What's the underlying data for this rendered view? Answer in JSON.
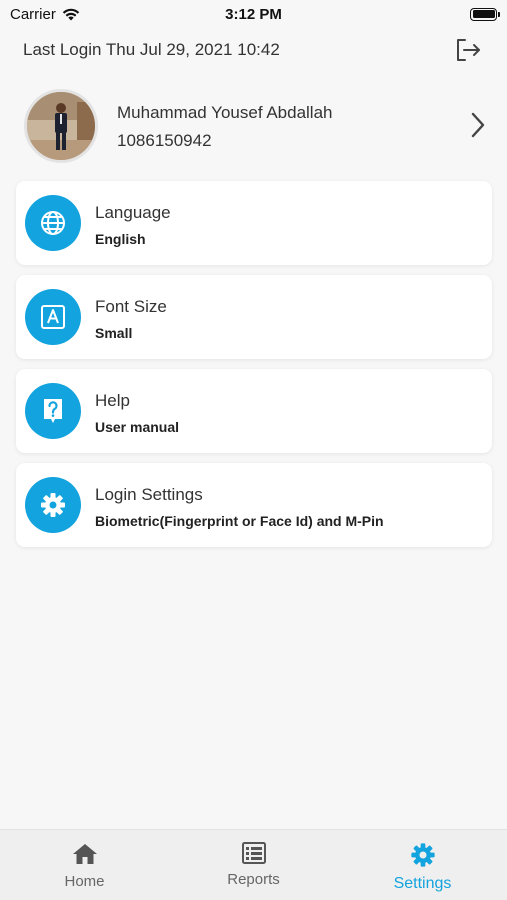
{
  "status_bar": {
    "carrier": "Carrier",
    "time": "3:12 PM"
  },
  "header": {
    "last_login": "Last Login Thu Jul 29, 2021 10:42",
    "logout_icon": "logout-icon"
  },
  "profile": {
    "name": "Muhammad Yousef Abdallah",
    "id_number": "1086150942"
  },
  "settings": [
    {
      "title": "Language",
      "value": "English",
      "icon": "globe-icon"
    },
    {
      "title": "Font Size",
      "value": "Small",
      "icon": "font-icon"
    },
    {
      "title": "Help",
      "value": "User manual",
      "icon": "help-icon"
    },
    {
      "title": "Login Settings",
      "value": "Biometric(Fingerprint or Face Id) and M-Pin",
      "icon": "gear-icon"
    }
  ],
  "tabs": [
    {
      "label": "Home",
      "icon": "home-icon"
    },
    {
      "label": "Reports",
      "icon": "list-icon"
    },
    {
      "label": "Settings",
      "icon": "gear-icon",
      "active": true
    }
  ],
  "colors": {
    "accent": "#13a3de",
    "background": "#f7f7f7",
    "tab_bar": "#efefef"
  }
}
